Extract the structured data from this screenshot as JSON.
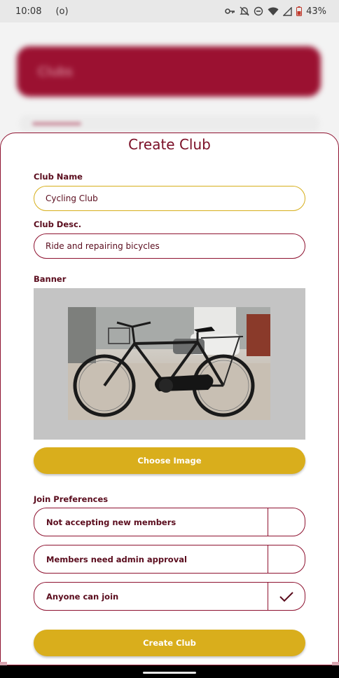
{
  "status_bar": {
    "time": "10:08",
    "indicator": "(o)",
    "battery": "43%"
  },
  "background": {
    "header_title": "Clubs"
  },
  "sheet": {
    "title": "Create Club",
    "club_name": {
      "label": "Club Name",
      "value": "Cycling Club"
    },
    "club_desc": {
      "label": "Club Desc.",
      "value": "Ride and repairing bicycles"
    },
    "banner": {
      "label": "Banner"
    },
    "choose_image_label": "Choose Image",
    "join_preferences": {
      "label": "Join Preferences",
      "options": [
        {
          "label": "Not accepting new members",
          "checked": false
        },
        {
          "label": "Members need admin approval",
          "checked": false
        },
        {
          "label": "Anyone can join",
          "checked": true
        }
      ]
    },
    "create_button_label": "Create Club"
  },
  "colors": {
    "primary": "#8e1230",
    "accent": "#d9ae1c",
    "text": "#5a0c1d"
  }
}
